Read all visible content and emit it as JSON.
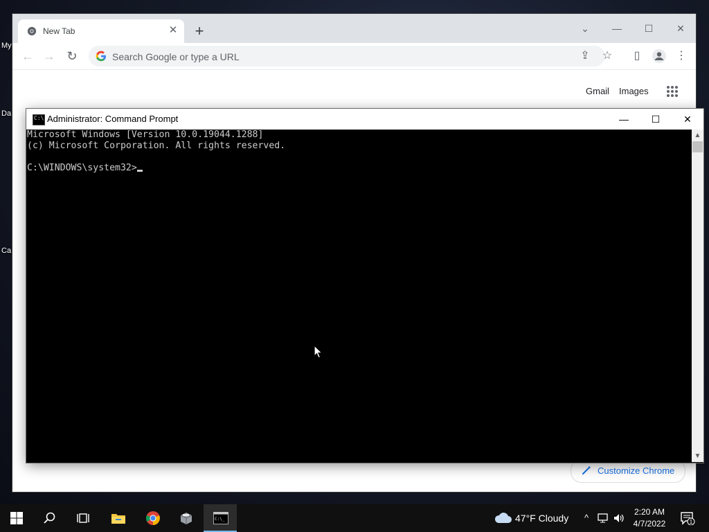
{
  "desktop": {
    "icon_labels": [
      "My",
      "Da",
      "Ca"
    ]
  },
  "chrome": {
    "tab_title": "New Tab",
    "tab_close_glyph": "✕",
    "new_tab_glyph": "+",
    "window_controls": {
      "tabsearch": "⌄",
      "minimize": "—",
      "maximize": "☐",
      "close": "✕"
    },
    "omnibox_placeholder": "Search Google or type a URL",
    "ntp": {
      "gmail": "Gmail",
      "images": "Images",
      "customize_label": "Customize Chrome"
    },
    "accent": "#1a73e8"
  },
  "cmd": {
    "title": "Administrator: Command Prompt",
    "lines": [
      "Microsoft Windows [Version 10.0.19044.1288]",
      "(c) Microsoft Corporation. All rights reserved.",
      "",
      "C:\\WINDOWS\\system32>"
    ],
    "controls": {
      "minimize": "—",
      "maximize": "☐",
      "close": "✕"
    }
  },
  "taskbar": {
    "weather_text": "47°F  Cloudy",
    "clock_time": "2:20 AM",
    "clock_date": "4/7/2022",
    "notification_count": "1",
    "apps": [
      "start-icon",
      "search-icon",
      "task-view-icon",
      "file-explorer-icon",
      "chrome-icon",
      "package-icon",
      "cmd-icon"
    ]
  }
}
